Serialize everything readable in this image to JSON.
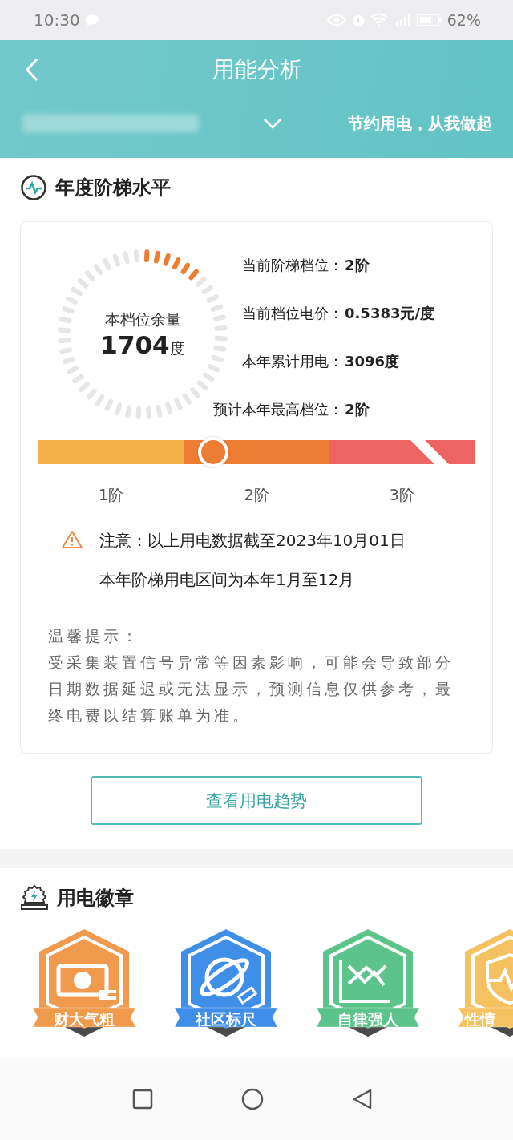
{
  "status_bar": {
    "time": "10:30",
    "battery": "62%"
  },
  "header": {
    "title": "用能分析",
    "slogan": "节约用电，从我做起"
  },
  "ladder": {
    "title": "年度阶梯水平",
    "gauge": {
      "label": "本档位余量",
      "value": "1704",
      "unit": "度"
    },
    "stats": [
      {
        "label": "当前阶梯档位：",
        "value": "2阶"
      },
      {
        "label": "当前档位电价：",
        "value": "0.5383元/度"
      },
      {
        "label": "本年累计用电：",
        "value": "3096度"
      },
      {
        "label": "预计本年最高档位：",
        "value": "2阶"
      }
    ],
    "tiers": [
      {
        "label": "1阶",
        "color": "#f5b04a"
      },
      {
        "label": "2阶",
        "color": "#ee7d34"
      },
      {
        "label": "3阶",
        "color": "#ee6464"
      }
    ],
    "notice": [
      "注意：以上用电数据截至2023年10月01日",
      "本年阶梯用电区间为本年1月至12月"
    ],
    "tip_title": "温馨提示：",
    "tip": "受采集装置信号异常等因素影响，可能会导致部分日期数据延迟或无法显示，预测信息仅供参考，最终电费以结算账单为准。",
    "button": "查看用电趋势"
  },
  "badges": {
    "title": "用电徽章",
    "items": [
      {
        "label": "财大气粗",
        "color": "#f09a4e",
        "kind": "money"
      },
      {
        "label": "社区标尺",
        "color": "#3f8ee8",
        "kind": "planet"
      },
      {
        "label": "自律强人",
        "color": "#5cc48a",
        "kind": "chart"
      },
      {
        "label": "性情",
        "color": "#f5c262",
        "kind": "shield"
      }
    ]
  }
}
